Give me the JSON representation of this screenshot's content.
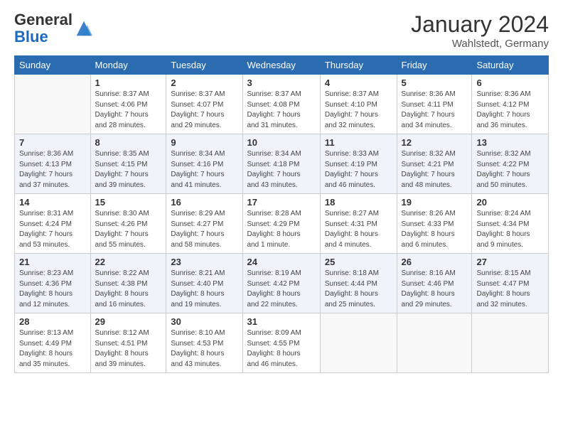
{
  "logo": {
    "general": "General",
    "blue": "Blue"
  },
  "header": {
    "month": "January 2024",
    "location": "Wahlstedt, Germany"
  },
  "days_of_week": [
    "Sunday",
    "Monday",
    "Tuesday",
    "Wednesday",
    "Thursday",
    "Friday",
    "Saturday"
  ],
  "weeks": [
    [
      {
        "day": "",
        "info": ""
      },
      {
        "day": "1",
        "info": "Sunrise: 8:37 AM\nSunset: 4:06 PM\nDaylight: 7 hours\nand 28 minutes."
      },
      {
        "day": "2",
        "info": "Sunrise: 8:37 AM\nSunset: 4:07 PM\nDaylight: 7 hours\nand 29 minutes."
      },
      {
        "day": "3",
        "info": "Sunrise: 8:37 AM\nSunset: 4:08 PM\nDaylight: 7 hours\nand 31 minutes."
      },
      {
        "day": "4",
        "info": "Sunrise: 8:37 AM\nSunset: 4:10 PM\nDaylight: 7 hours\nand 32 minutes."
      },
      {
        "day": "5",
        "info": "Sunrise: 8:36 AM\nSunset: 4:11 PM\nDaylight: 7 hours\nand 34 minutes."
      },
      {
        "day": "6",
        "info": "Sunrise: 8:36 AM\nSunset: 4:12 PM\nDaylight: 7 hours\nand 36 minutes."
      }
    ],
    [
      {
        "day": "7",
        "info": "Sunrise: 8:36 AM\nSunset: 4:13 PM\nDaylight: 7 hours\nand 37 minutes."
      },
      {
        "day": "8",
        "info": "Sunrise: 8:35 AM\nSunset: 4:15 PM\nDaylight: 7 hours\nand 39 minutes."
      },
      {
        "day": "9",
        "info": "Sunrise: 8:34 AM\nSunset: 4:16 PM\nDaylight: 7 hours\nand 41 minutes."
      },
      {
        "day": "10",
        "info": "Sunrise: 8:34 AM\nSunset: 4:18 PM\nDaylight: 7 hours\nand 43 minutes."
      },
      {
        "day": "11",
        "info": "Sunrise: 8:33 AM\nSunset: 4:19 PM\nDaylight: 7 hours\nand 46 minutes."
      },
      {
        "day": "12",
        "info": "Sunrise: 8:32 AM\nSunset: 4:21 PM\nDaylight: 7 hours\nand 48 minutes."
      },
      {
        "day": "13",
        "info": "Sunrise: 8:32 AM\nSunset: 4:22 PM\nDaylight: 7 hours\nand 50 minutes."
      }
    ],
    [
      {
        "day": "14",
        "info": "Sunrise: 8:31 AM\nSunset: 4:24 PM\nDaylight: 7 hours\nand 53 minutes."
      },
      {
        "day": "15",
        "info": "Sunrise: 8:30 AM\nSunset: 4:26 PM\nDaylight: 7 hours\nand 55 minutes."
      },
      {
        "day": "16",
        "info": "Sunrise: 8:29 AM\nSunset: 4:27 PM\nDaylight: 7 hours\nand 58 minutes."
      },
      {
        "day": "17",
        "info": "Sunrise: 8:28 AM\nSunset: 4:29 PM\nDaylight: 8 hours\nand 1 minute."
      },
      {
        "day": "18",
        "info": "Sunrise: 8:27 AM\nSunset: 4:31 PM\nDaylight: 8 hours\nand 4 minutes."
      },
      {
        "day": "19",
        "info": "Sunrise: 8:26 AM\nSunset: 4:33 PM\nDaylight: 8 hours\nand 6 minutes."
      },
      {
        "day": "20",
        "info": "Sunrise: 8:24 AM\nSunset: 4:34 PM\nDaylight: 8 hours\nand 9 minutes."
      }
    ],
    [
      {
        "day": "21",
        "info": "Sunrise: 8:23 AM\nSunset: 4:36 PM\nDaylight: 8 hours\nand 12 minutes."
      },
      {
        "day": "22",
        "info": "Sunrise: 8:22 AM\nSunset: 4:38 PM\nDaylight: 8 hours\nand 16 minutes."
      },
      {
        "day": "23",
        "info": "Sunrise: 8:21 AM\nSunset: 4:40 PM\nDaylight: 8 hours\nand 19 minutes."
      },
      {
        "day": "24",
        "info": "Sunrise: 8:19 AM\nSunset: 4:42 PM\nDaylight: 8 hours\nand 22 minutes."
      },
      {
        "day": "25",
        "info": "Sunrise: 8:18 AM\nSunset: 4:44 PM\nDaylight: 8 hours\nand 25 minutes."
      },
      {
        "day": "26",
        "info": "Sunrise: 8:16 AM\nSunset: 4:46 PM\nDaylight: 8 hours\nand 29 minutes."
      },
      {
        "day": "27",
        "info": "Sunrise: 8:15 AM\nSunset: 4:47 PM\nDaylight: 8 hours\nand 32 minutes."
      }
    ],
    [
      {
        "day": "28",
        "info": "Sunrise: 8:13 AM\nSunset: 4:49 PM\nDaylight: 8 hours\nand 35 minutes."
      },
      {
        "day": "29",
        "info": "Sunrise: 8:12 AM\nSunset: 4:51 PM\nDaylight: 8 hours\nand 39 minutes."
      },
      {
        "day": "30",
        "info": "Sunrise: 8:10 AM\nSunset: 4:53 PM\nDaylight: 8 hours\nand 43 minutes."
      },
      {
        "day": "31",
        "info": "Sunrise: 8:09 AM\nSunset: 4:55 PM\nDaylight: 8 hours\nand 46 minutes."
      },
      {
        "day": "",
        "info": ""
      },
      {
        "day": "",
        "info": ""
      },
      {
        "day": "",
        "info": ""
      }
    ]
  ]
}
